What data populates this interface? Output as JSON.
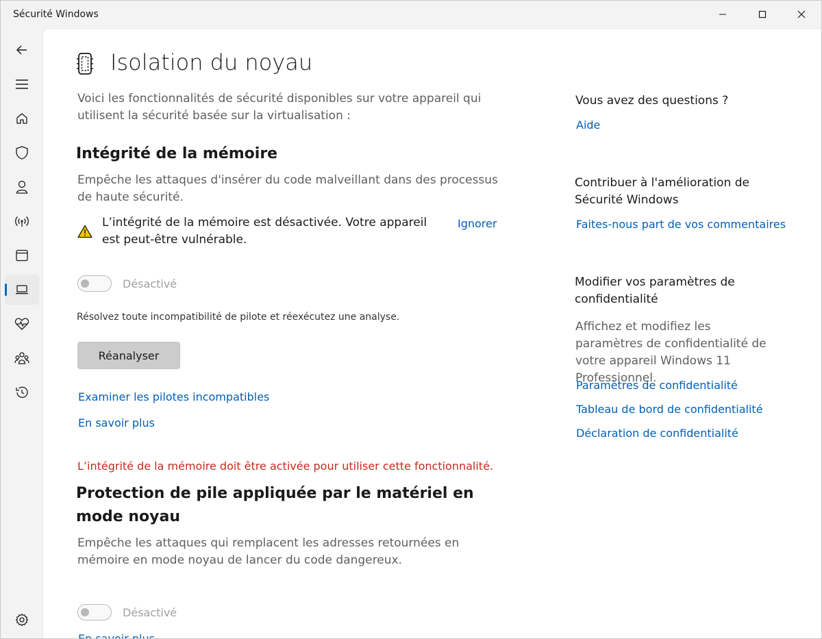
{
  "window": {
    "title": "Sécurité Windows"
  },
  "page": {
    "title": "Isolation du noyau",
    "intro": "Voici les fonctionnalités de sécurité disponibles sur votre appareil qui utilisent la sécurité basée sur la virtualisation :"
  },
  "memory_integrity": {
    "heading": "Intégrité de la mémoire",
    "description": "Empêche les attaques d'insérer du code malveillant dans des processus de haute sécurité.",
    "warning": "L’intégrité de la mémoire est désactivée. Votre appareil est peut-être vulnérable.",
    "ignore_link": "Ignorer",
    "toggle_label": "Désactivé",
    "driver_hint": "Résolvez toute incompatibilité de pilote et réexécutez une analyse.",
    "rescan_button": "Réanalyser",
    "examine_link": "Examiner les pilotes incompatibles",
    "learn_more_link": "En savoir plus",
    "toggle_on": false
  },
  "stack_protection": {
    "requirement_error": "L’intégrité de la mémoire doit être activée pour utiliser cette fonctionnalité.",
    "heading": "Protection de pile appliquée par le matériel en mode noyau",
    "description": "Empêche les attaques qui remplacent les adresses retournées en mémoire en mode noyau de lancer du code dangereux.",
    "toggle_label": "Désactivé",
    "learn_more_link": "En savoir plus",
    "toggle_on": false
  },
  "side_panel": {
    "questions_heading": "Vous avez des questions ?",
    "help_link": "Aide",
    "contribute_heading": "Contribuer à l'amélioration de Sécurité Windows",
    "feedback_link": "Faites-nous part de vos commentaires",
    "privacy_heading": "Modifier vos paramètres de confidentialité",
    "privacy_text": "Affichez et modifiez les paramètres de confidentialité de votre appareil Windows 11 Professionnel.",
    "privacy_links": [
      "Paramètres de confidentialité",
      "Tableau de bord de confidentialité",
      "Déclaration de confidentialité"
    ]
  },
  "sidebar": {
    "items": [
      {
        "icon": "back-arrow-icon"
      },
      {
        "icon": "hamburger-menu-icon"
      },
      {
        "icon": "home-icon"
      },
      {
        "icon": "shield-icon"
      },
      {
        "icon": "account-icon"
      },
      {
        "icon": "network-icon"
      },
      {
        "icon": "app-browser-icon"
      },
      {
        "icon": "device-security-icon",
        "active": true
      },
      {
        "icon": "health-heart-icon"
      },
      {
        "icon": "family-icon"
      },
      {
        "icon": "history-icon"
      },
      {
        "icon": "settings-gear-icon"
      }
    ]
  },
  "colors": {
    "accent": "#0067c0",
    "link": "#005fb8",
    "error": "#c42b1c",
    "warning": "#f9c700"
  }
}
